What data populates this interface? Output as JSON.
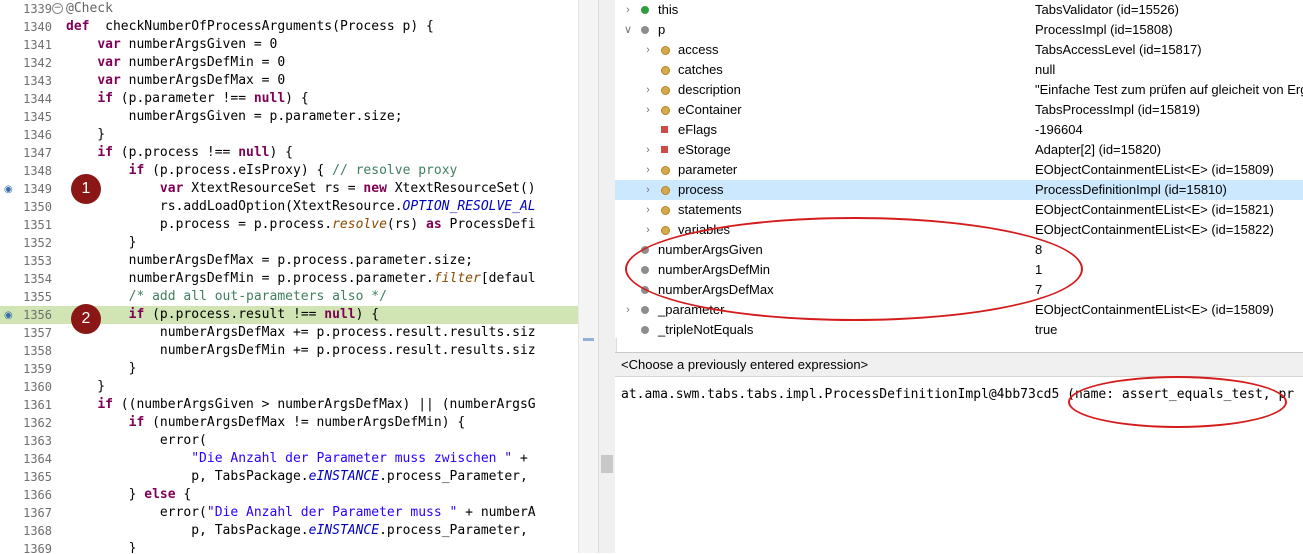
{
  "editor": {
    "lines": [
      {
        "n": "1339",
        "t": [
          [
            "ann",
            "@Check"
          ]
        ],
        "fold": true
      },
      {
        "n": "1340",
        "t": [
          [
            "kw",
            "def"
          ],
          [
            "",
            "  checkNumberOfProcessArguments(Process p) {"
          ]
        ]
      },
      {
        "n": "1341",
        "t": [
          [
            "",
            "    "
          ],
          [
            "kw",
            "var"
          ],
          [
            "",
            "",
            " numberArgsGiven = 0"
          ]
        ]
      },
      {
        "n": "1342",
        "t": [
          [
            "",
            "    "
          ],
          [
            "kw",
            "var"
          ],
          [
            "",
            " numberArgsDefMin = 0"
          ]
        ]
      },
      {
        "n": "1343",
        "t": [
          [
            "",
            "    "
          ],
          [
            "kw",
            "var"
          ],
          [
            "",
            " numberArgsDefMax = 0"
          ]
        ]
      },
      {
        "n": "1344",
        "t": [
          [
            "",
            "    "
          ],
          [
            "kw",
            "if"
          ],
          [
            "",
            " (p.parameter !== "
          ],
          [
            "kw",
            "null"
          ],
          [
            "",
            ") {"
          ]
        ]
      },
      {
        "n": "1345",
        "t": [
          [
            "",
            "        numberArgsGiven = p.parameter.size;"
          ]
        ]
      },
      {
        "n": "1346",
        "t": [
          [
            "",
            "    }"
          ]
        ]
      },
      {
        "n": "1347",
        "t": [
          [
            "",
            "    "
          ],
          [
            "kw",
            "if"
          ],
          [
            "",
            " (p.process !== "
          ],
          [
            "kw",
            "null"
          ],
          [
            "",
            ") {"
          ]
        ]
      },
      {
        "n": "1348",
        "t": [
          [
            "",
            "        "
          ],
          [
            "kw",
            "if"
          ],
          [
            "",
            " (p.process.eIsProxy) { "
          ],
          [
            "cm",
            "// resolve proxy"
          ]
        ]
      },
      {
        "n": "1349",
        "t": [
          [
            "",
            "            "
          ],
          [
            "kw",
            "var"
          ],
          [
            "",
            " XtextResourceSet rs = "
          ],
          [
            "kw",
            "new"
          ],
          [
            "",
            " XtextResourceSet()"
          ]
        ],
        "bp": true
      },
      {
        "n": "1350",
        "t": [
          [
            "",
            "            rs.addLoadOption(XtextResource."
          ],
          [
            "fd",
            "OPTION_RESOLVE_AL"
          ]
        ]
      },
      {
        "n": "1351",
        "t": [
          [
            "",
            "            p.process = p.process."
          ],
          [
            "it",
            "resolve"
          ],
          [
            "",
            "(rs) "
          ],
          [
            "kw",
            "as"
          ],
          [
            "",
            " ProcessDefi"
          ]
        ]
      },
      {
        "n": "1352",
        "t": [
          [
            "",
            "        }"
          ]
        ]
      },
      {
        "n": "1353",
        "t": [
          [
            "",
            "        numberArgsDefMax = p.process.parameter.size;"
          ]
        ]
      },
      {
        "n": "1354",
        "t": [
          [
            "",
            "        numberArgsDefMin = p.process.parameter."
          ],
          [
            "it",
            "filter"
          ],
          [
            "",
            "[defaul"
          ]
        ]
      },
      {
        "n": "1355",
        "t": [
          [
            "",
            "        "
          ],
          [
            "cm",
            "/* add all out-parameters also */"
          ]
        ]
      },
      {
        "n": "1356",
        "t": [
          [
            "",
            "        "
          ],
          [
            "kw",
            "if"
          ],
          [
            "",
            " (p.process.result !== "
          ],
          [
            "kw",
            "null"
          ],
          [
            "",
            ") {"
          ]
        ],
        "hl": true,
        "bp": true
      },
      {
        "n": "1357",
        "t": [
          [
            "",
            "            numberArgsDefMax += p.process.result.results.siz"
          ]
        ]
      },
      {
        "n": "1358",
        "t": [
          [
            "",
            "            numberArgsDefMin += p.process.result.results.siz"
          ]
        ]
      },
      {
        "n": "1359",
        "t": [
          [
            "",
            "        }"
          ]
        ]
      },
      {
        "n": "1360",
        "t": [
          [
            "",
            "    }"
          ]
        ]
      },
      {
        "n": "1361",
        "t": [
          [
            "",
            "    "
          ],
          [
            "kw",
            "if"
          ],
          [
            "",
            " ((numberArgsGiven > numberArgsDefMax) || (numberArgsG"
          ]
        ]
      },
      {
        "n": "1362",
        "t": [
          [
            "",
            "        "
          ],
          [
            "kw",
            "if"
          ],
          [
            "",
            " (numberArgsDefMax != numberArgsDefMin) {"
          ]
        ]
      },
      {
        "n": "1363",
        "t": [
          [
            "",
            "            error("
          ]
        ]
      },
      {
        "n": "1364",
        "t": [
          [
            "",
            "                "
          ],
          [
            "st",
            "\"Die Anzahl der Parameter muss zwischen \""
          ],
          [
            "",
            " + "
          ]
        ]
      },
      {
        "n": "1365",
        "t": [
          [
            "",
            "                p, TabsPackage."
          ],
          [
            "fd",
            "eINSTANCE"
          ],
          [
            "",
            ".process_Parameter, "
          ]
        ]
      },
      {
        "n": "1366",
        "t": [
          [
            "",
            "        } "
          ],
          [
            "kw",
            "else"
          ],
          [
            "",
            " {"
          ]
        ]
      },
      {
        "n": "1367",
        "t": [
          [
            "",
            "            error("
          ],
          [
            "st",
            "\"Die Anzahl der Parameter muss \""
          ],
          [
            "",
            " + numberA"
          ]
        ]
      },
      {
        "n": "1368",
        "t": [
          [
            "",
            "                p, TabsPackage."
          ],
          [
            "fd",
            "eINSTANCE"
          ],
          [
            "",
            ".process_Parameter, "
          ]
        ]
      },
      {
        "n": "1369",
        "t": [
          [
            "",
            "        }"
          ]
        ]
      }
    ]
  },
  "badges": [
    "1",
    "2"
  ],
  "variables": [
    {
      "name": "this",
      "value": "TabsValidator  (id=15526)",
      "icon": "pub",
      "level": 0,
      "chev": ">"
    },
    {
      "name": "p",
      "value": "ProcessImpl  (id=15808)",
      "icon": "local",
      "level": 0,
      "chev": "v"
    },
    {
      "name": "access",
      "value": "TabsAccessLevel  (id=15817)",
      "icon": "prot",
      "level": 1,
      "chev": ">"
    },
    {
      "name": "catches",
      "value": "null",
      "icon": "prot",
      "level": 1,
      "chev": ""
    },
    {
      "name": "description",
      "value": "\"Einfache Test zum prüfen auf gleicheit von Erg",
      "icon": "prot",
      "level": 1,
      "chev": ">"
    },
    {
      "name": "eContainer",
      "value": "TabsProcessImpl  (id=15819)",
      "icon": "prot",
      "level": 1,
      "chev": ">"
    },
    {
      "name": "eFlags",
      "value": "-196604",
      "icon": "priv",
      "level": 1,
      "chev": ""
    },
    {
      "name": "eStorage",
      "value": "Adapter[2]  (id=15820)",
      "icon": "priv",
      "level": 1,
      "chev": ">"
    },
    {
      "name": "parameter",
      "value": "EObjectContainmentEList<E>  (id=15809)",
      "icon": "prot",
      "level": 1,
      "chev": ">"
    },
    {
      "name": "process",
      "value": "ProcessDefinitionImpl  (id=15810)",
      "icon": "prot",
      "level": 1,
      "chev": ">",
      "sel": true
    },
    {
      "name": "statements",
      "value": "EObjectContainmentEList<E>  (id=15821)",
      "icon": "prot",
      "level": 1,
      "chev": ">"
    },
    {
      "name": "variables",
      "value": "EObjectContainmentEList<E>  (id=15822)",
      "icon": "prot",
      "level": 1,
      "chev": ">"
    },
    {
      "name": "numberArgsGiven",
      "value": "8",
      "icon": "local",
      "level": 0,
      "chev": ""
    },
    {
      "name": "numberArgsDefMin",
      "value": "1",
      "icon": "local",
      "level": 0,
      "chev": ""
    },
    {
      "name": "numberArgsDefMax",
      "value": "7",
      "icon": "local",
      "level": 0,
      "chev": ""
    },
    {
      "name": "_parameter",
      "value": "EObjectContainmentEList<E>  (id=15809)",
      "icon": "local",
      "level": 0,
      "chev": ">"
    },
    {
      "name": "_tripleNotEquals",
      "value": "true",
      "icon": "local",
      "level": 0,
      "chev": ""
    }
  ],
  "expression": {
    "placeholder": "<Choose a previously entered expression>",
    "result": "at.ama.swm.tabs.tabs.impl.ProcessDefinitionImpl@4bb73cd5 (name: assert_equals_test, pr"
  }
}
